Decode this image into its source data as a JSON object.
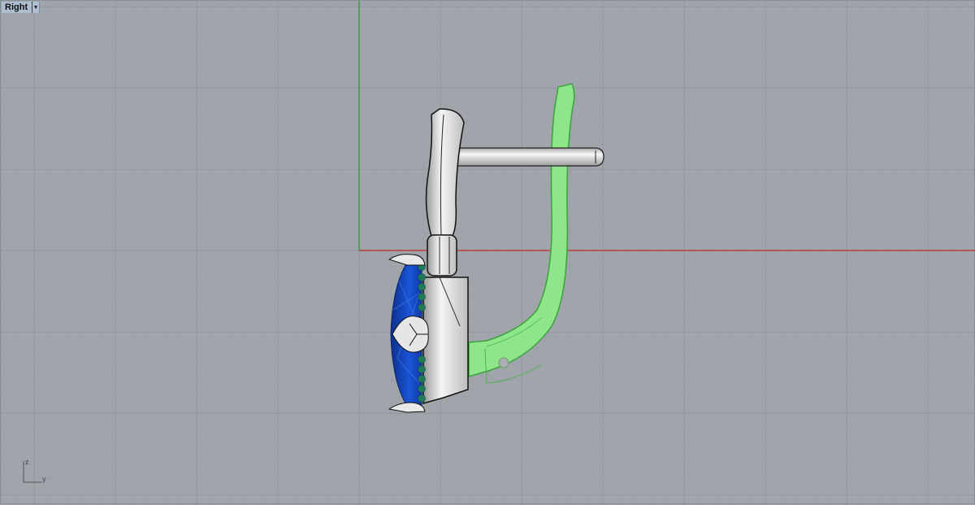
{
  "viewport": {
    "title": "Right",
    "menu_icon": "triangle-down",
    "axis_labels": {
      "vertical": "z",
      "horizontal": "y"
    },
    "colors": {
      "background": "#a0a5ac",
      "x_axis": "#c0282a",
      "y_axis": "#1f9a2a",
      "gem": "#1a4fd0",
      "selected": "#8fe68a",
      "accent_stones": "#1f7a5a"
    }
  }
}
